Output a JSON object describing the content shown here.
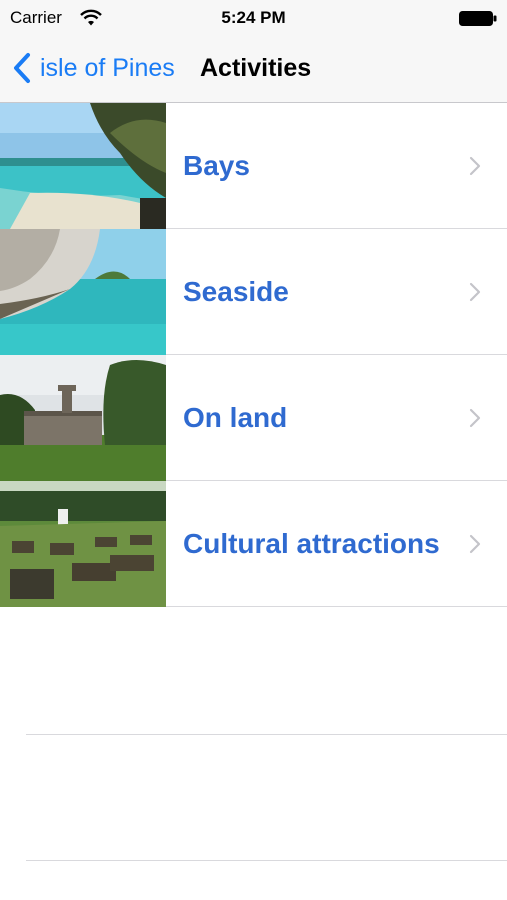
{
  "status_bar": {
    "carrier": "Carrier",
    "time": "5:24 PM",
    "icons": [
      "wifi-icon",
      "battery-icon"
    ]
  },
  "nav": {
    "back_label": "isle of Pines",
    "title": "Activities",
    "accent_color": "#1a7cf5"
  },
  "rows": [
    {
      "label": "Bays",
      "image": "beach-bay-photo"
    },
    {
      "label": "Seaside",
      "image": "cliff-lagoon-photo"
    },
    {
      "label": "On land",
      "image": "stone-ruin-photo"
    },
    {
      "label": "Cultural attractions",
      "image": "cemetery-photo"
    }
  ],
  "row_text_color": "#2f6ad0"
}
